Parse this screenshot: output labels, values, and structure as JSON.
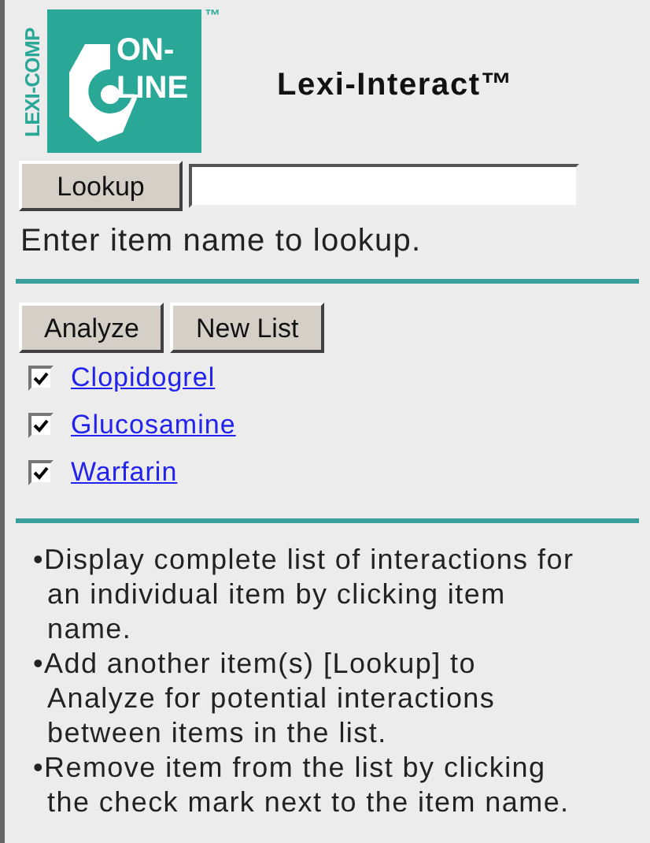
{
  "logo": {
    "side_text": "LEXI-COMP",
    "top_text": "ON-",
    "bottom_text": "LINE",
    "trademark": "™"
  },
  "title": "Lexi-Interact™",
  "lookup": {
    "button": "Lookup",
    "hint": "Enter item name to lookup."
  },
  "buttons": [
    "Analyze",
    "New List"
  ],
  "items": [
    {
      "name": "Clopidogrel",
      "checked": true
    },
    {
      "name": "Glucosamine",
      "checked": true
    },
    {
      "name": "Warfarin",
      "checked": true
    }
  ],
  "notes": [
    "•Display complete list of interactions for an individual item by clicking item name.",
    "•Add another item(s) [Lookup] to Analyze for potential interactions between items in the list.",
    "•Remove item from the list by clicking the check mark next to the item name."
  ]
}
